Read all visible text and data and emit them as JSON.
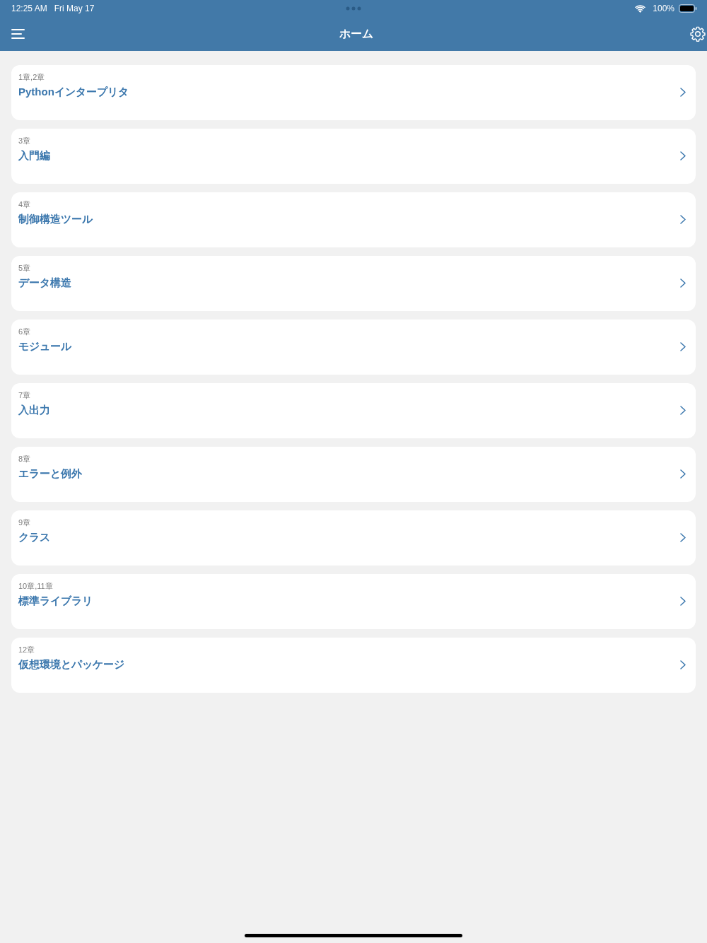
{
  "status_bar": {
    "time": "12:25 AM",
    "date": "Fri May 17",
    "battery": "100%"
  },
  "nav_bar": {
    "title": "ホーム"
  },
  "chapters": [
    {
      "chapter": "1章,2章",
      "title": "Pythonインタープリタ"
    },
    {
      "chapter": "3章",
      "title": "入門編"
    },
    {
      "chapter": "4章",
      "title": "制御構造ツール"
    },
    {
      "chapter": "5章",
      "title": "データ構造"
    },
    {
      "chapter": "6章",
      "title": "モジュール"
    },
    {
      "chapter": "7章",
      "title": "入出力"
    },
    {
      "chapter": "8章",
      "title": "エラーと例外"
    },
    {
      "chapter": "9章",
      "title": "クラス"
    },
    {
      "chapter": "10章,11章",
      "title": "標準ライブラリ"
    },
    {
      "chapter": "12章",
      "title": "仮想環境とパッケージ"
    }
  ]
}
